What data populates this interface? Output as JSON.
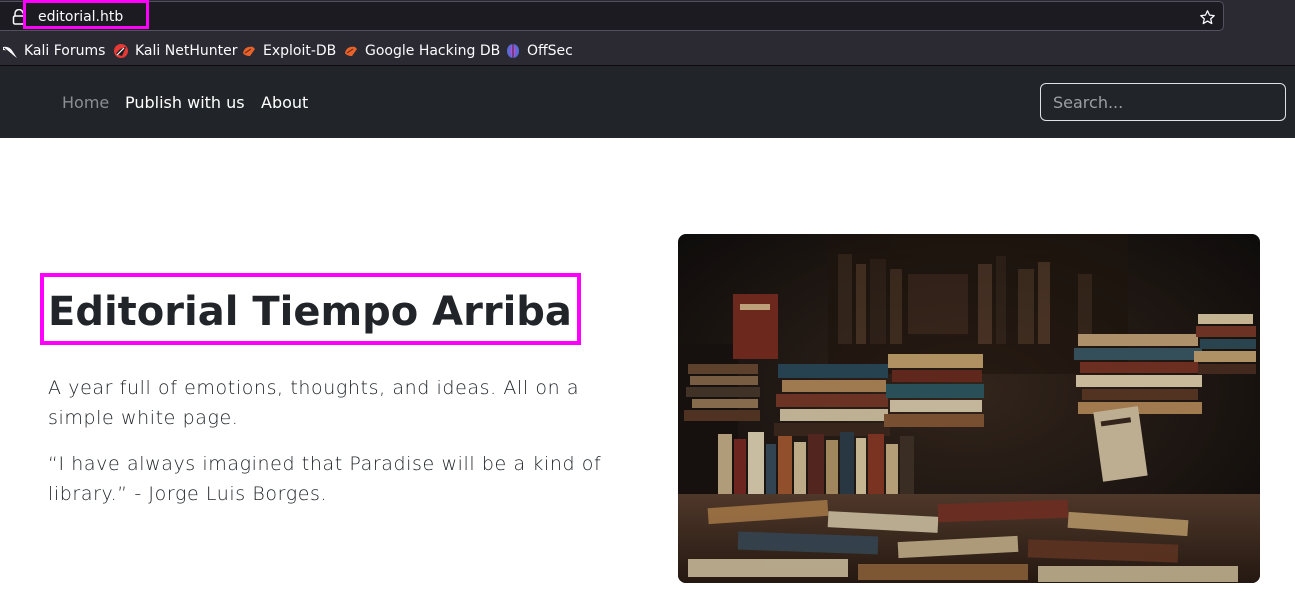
{
  "browser": {
    "url": "editorial.htb",
    "bookmarks": [
      {
        "label": "Kali Forums",
        "icon": "kali-dragon-icon"
      },
      {
        "label": "Kali NetHunter",
        "icon": "nethunter-icon"
      },
      {
        "label": "Exploit-DB",
        "icon": "exploit-db-icon"
      },
      {
        "label": "Google Hacking DB",
        "icon": "ghdb-icon"
      },
      {
        "label": "OffSec",
        "icon": "offsec-icon"
      }
    ]
  },
  "nav": {
    "links": [
      {
        "label": "Home",
        "active": true
      },
      {
        "label": "Publish with us",
        "active": false
      },
      {
        "label": "About",
        "active": false
      }
    ],
    "search_placeholder": "Search..."
  },
  "hero": {
    "title": "Editorial Tiempo Arriba",
    "paragraphs": [
      "A year full of emotions, thoughts, and ideas. All on a simple white page.",
      "“I have always imagined that Paradise will be a kind of library.” - Jorge Luis Borges."
    ],
    "image": "books-photo"
  },
  "colors": {
    "highlight": "#ff00ff",
    "navbar_bg": "#212529",
    "chrome_bg": "#2b2a33"
  }
}
